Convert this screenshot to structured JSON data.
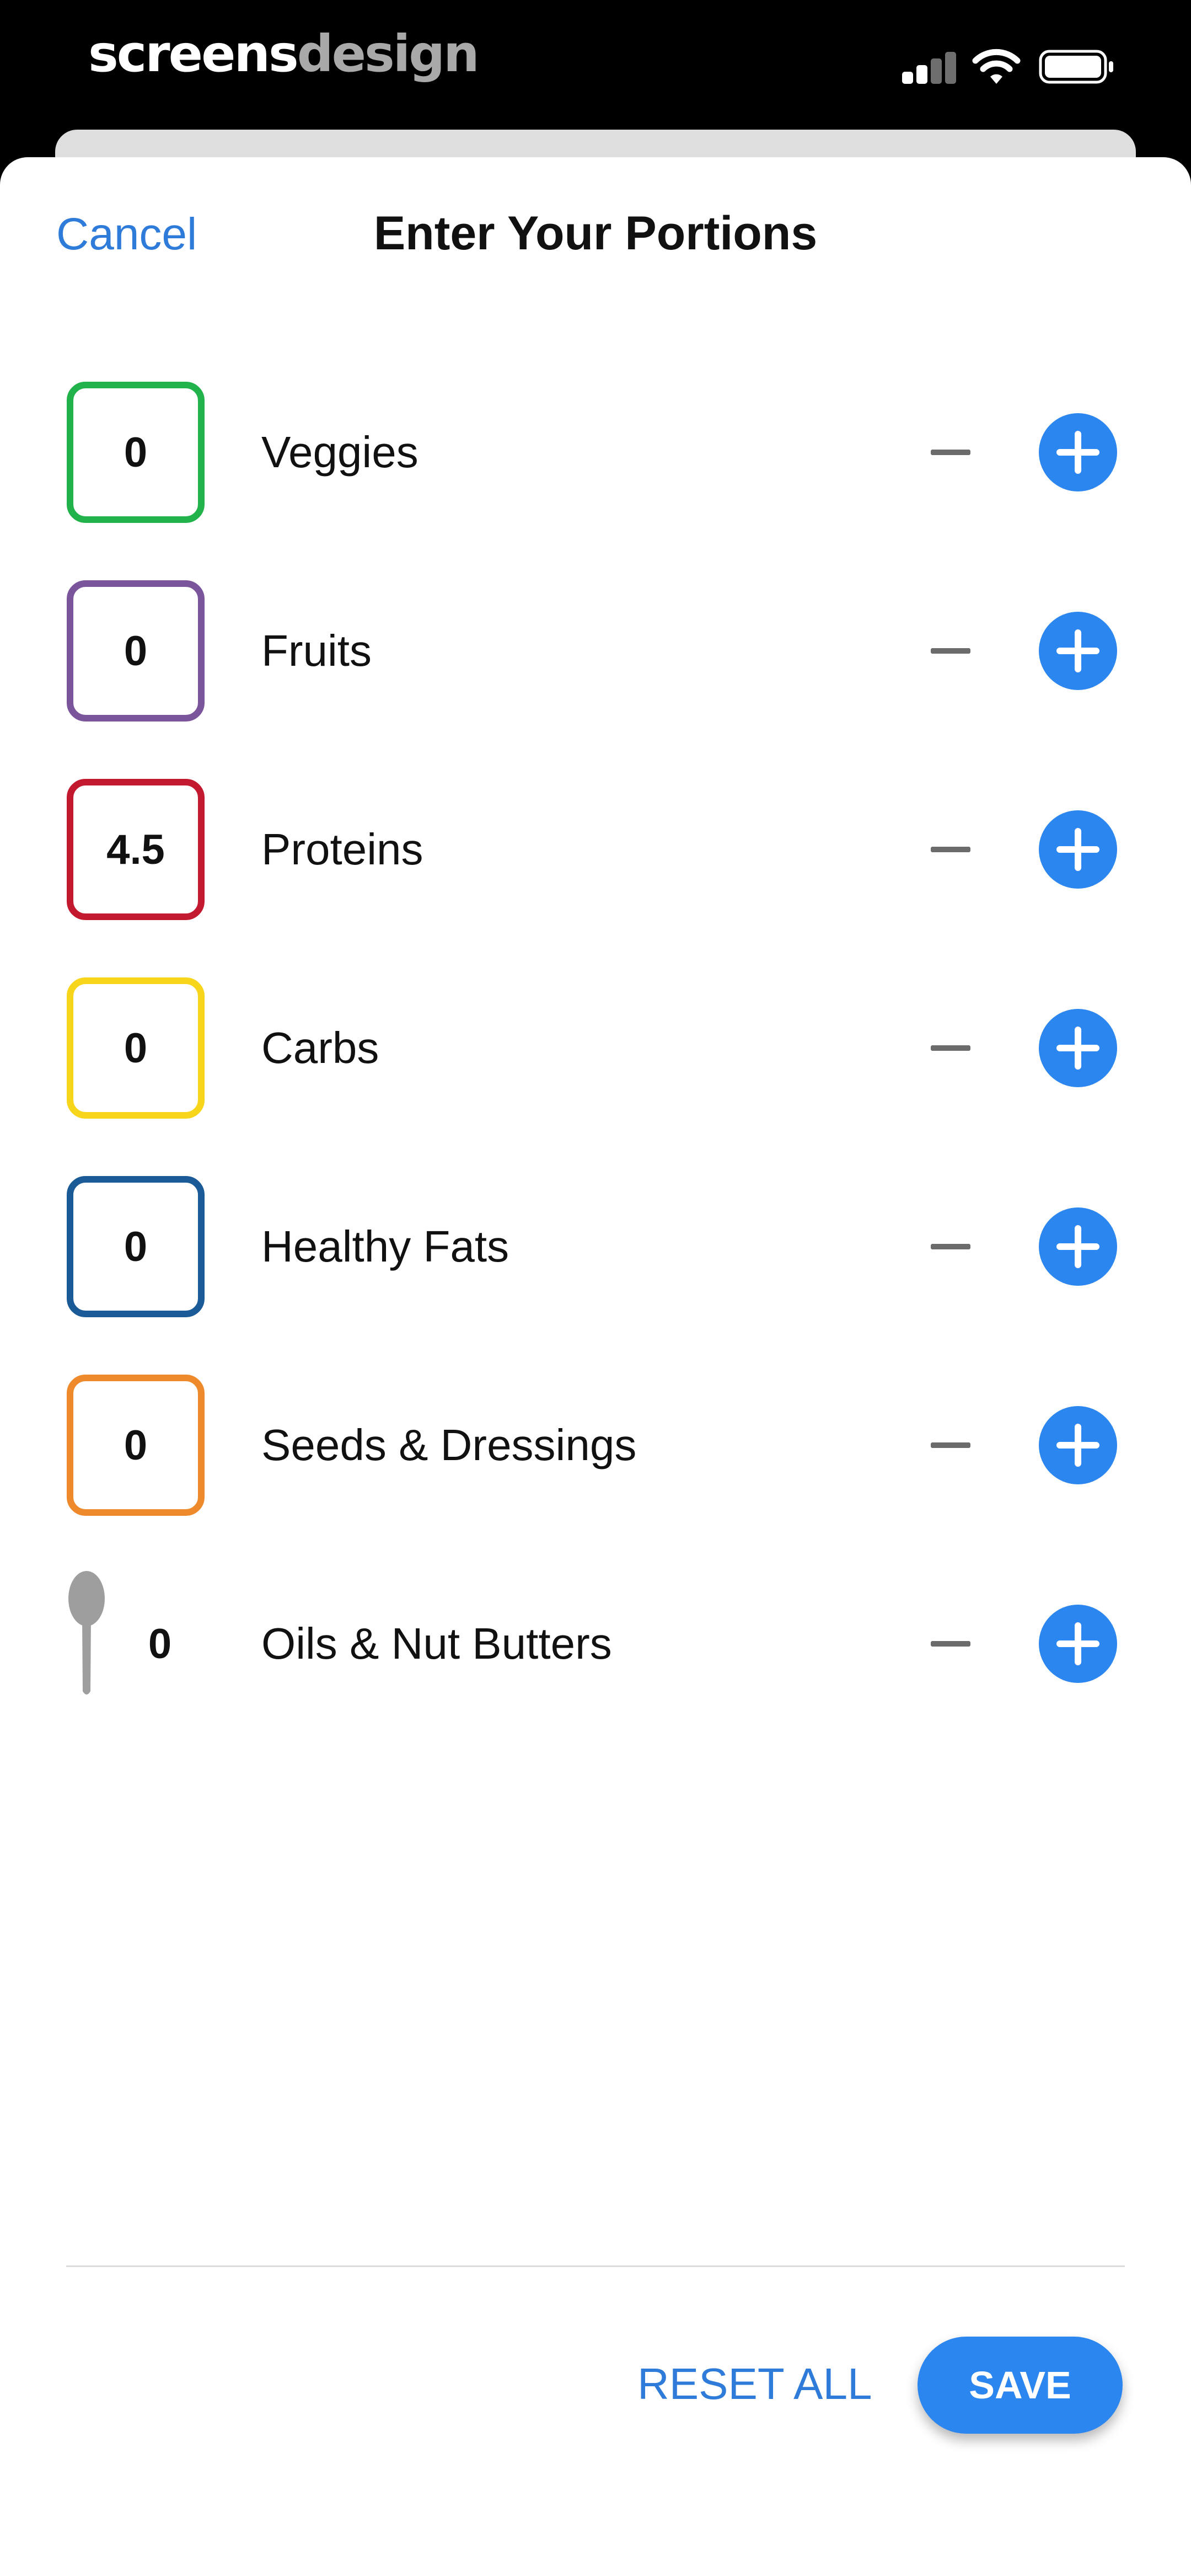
{
  "status_bar": {
    "brand_part1": "screens",
    "brand_part2": "design"
  },
  "header": {
    "cancel_label": "Cancel",
    "title": "Enter Your Portions"
  },
  "portions": [
    {
      "label": "Veggies",
      "value": "0",
      "color": "#21b24b"
    },
    {
      "label": "Fruits",
      "value": "0",
      "color": "#7b559b"
    },
    {
      "label": "Proteins",
      "value": "4.5",
      "color": "#c3192f"
    },
    {
      "label": "Carbs",
      "value": "0",
      "color": "#f7d51b"
    },
    {
      "label": "Healthy Fats",
      "value": "0",
      "color": "#1a5a96"
    },
    {
      "label": "Seeds & Dressings",
      "value": "0",
      "color": "#ee8a2c"
    },
    {
      "label": "Oils & Nut Butters",
      "value": "0",
      "color": "#9e9e9e",
      "icon": "spoon-icon"
    }
  ],
  "footer": {
    "reset_label": "RESET ALL",
    "save_label": "SAVE"
  },
  "colors": {
    "accent": "#2b86ef",
    "link": "#2f7bd9"
  }
}
